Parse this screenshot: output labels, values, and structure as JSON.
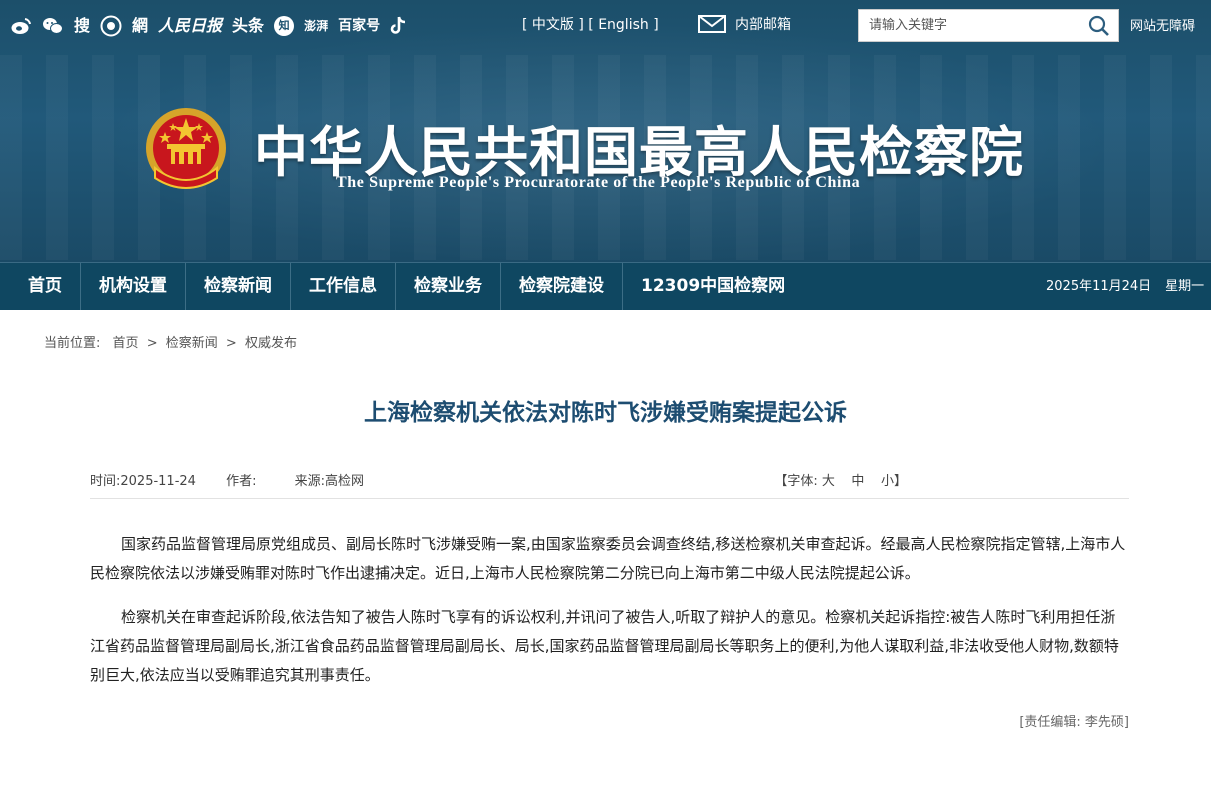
{
  "header": {
    "social": [
      "weibo-icon",
      "wechat-icon",
      "搜",
      "app-icon",
      "網",
      "人民日报",
      "头条",
      "知",
      "澎湃",
      "百家号",
      "douyin-icon"
    ],
    "lang_links": [
      "[ 中文版 ]",
      "[ English ]"
    ],
    "mail_label": "内部邮箱",
    "search_placeholder": "请输入关键字",
    "accessibility": "网站无障碍",
    "title_cn": "中华人民共和国最高人民检察院",
    "title_en": "The Supreme People's Procuratorate of the People's Republic of China"
  },
  "nav": {
    "items": [
      "首页",
      "机构设置",
      "检察新闻",
      "工作信息",
      "检察业务",
      "检察院建设",
      "12309中国检察网"
    ],
    "date": "2025年11月24日",
    "weekday": "星期一"
  },
  "breadcrumb": {
    "prefix": "当前位置:",
    "items": [
      "首页",
      "检察新闻",
      "权威发布"
    ],
    "sep": ">"
  },
  "article": {
    "title": "上海检察机关依法对陈时飞涉嫌受贿案提起公诉",
    "time": "时间:2025-11-24",
    "author": "作者:",
    "source": "来源:高检网",
    "fontsize_open": "【字体:",
    "font_large": "大",
    "font_medium": "中",
    "font_small": "小",
    "fontsize_close": "】",
    "paragraphs": [
      "国家药品监督管理局原党组成员、副局长陈时飞涉嫌受贿一案,由国家监察委员会调查终结,移送检察机关审查起诉。经最高人民检察院指定管辖,上海市人民检察院依法以涉嫌受贿罪对陈时飞作出逮捕决定。近日,上海市人民检察院第二分院已向上海市第二中级人民法院提起公诉。",
      "检察机关在审查起诉阶段,依法告知了被告人陈时飞享有的诉讼权利,并讯问了被告人,听取了辩护人的意见。检察机关起诉指控:被告人陈时飞利用担任浙江省药品监督管理局副局长,浙江省食品药品监督管理局副局长、局长,国家药品监督管理局副局长等职务上的便利,为他人谋取利益,非法收受他人财物,数额特别巨大,依法应当以受贿罪追究其刑事责任。"
    ],
    "editor": "[责任编辑: 李先硕]"
  }
}
